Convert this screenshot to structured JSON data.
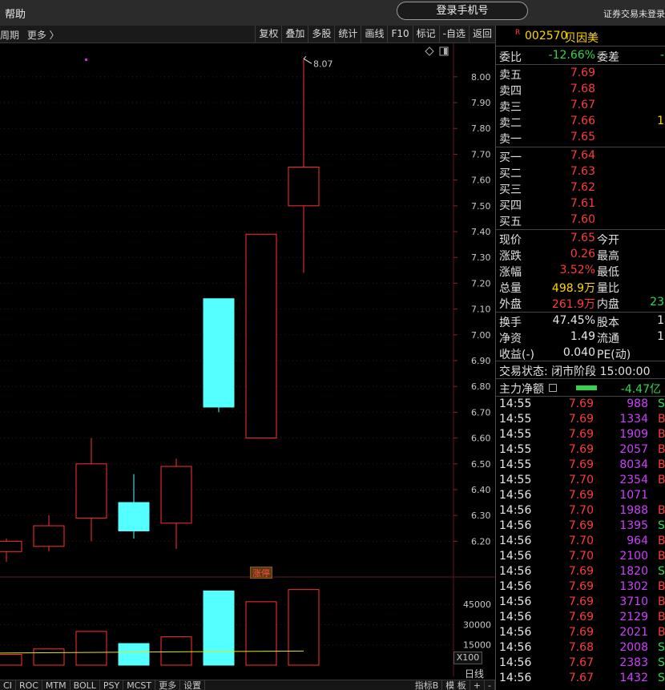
{
  "topbar": {
    "help": "帮助",
    "login_button": "登录手机号",
    "status": "证券交易未登录"
  },
  "toolbar": {
    "left": [
      "周期",
      "更多 〉"
    ],
    "right": [
      "复权",
      "叠加",
      "多股",
      "统计",
      "画线",
      "F10",
      "标记",
      "-自选",
      "返回"
    ]
  },
  "chart": {
    "max_label": "8.07",
    "tag_zt": "涨停",
    "x100": "X100",
    "day_line": "日线",
    "price_ticks": [
      "8.00",
      "7.90",
      "7.80",
      "7.70",
      "7.60",
      "7.50",
      "7.40",
      "7.30",
      "7.20",
      "7.10",
      "7.00",
      "6.90",
      "6.80",
      "6.70",
      "6.60",
      "6.50",
      "6.40",
      "6.30",
      "6.20"
    ],
    "volume_ticks": [
      "45000",
      "30000",
      "15000"
    ]
  },
  "chart_data": {
    "type": "candlestick",
    "price_ylim": [
      6.08,
      8.13
    ],
    "volume_ylim": [
      0,
      57000
    ],
    "max_price": 8.07,
    "candles": [
      {
        "open": 6.16,
        "close": 6.2,
        "high": 6.21,
        "low": 6.12,
        "volume": 8000
      },
      {
        "open": 6.18,
        "close": 6.26,
        "high": 6.3,
        "low": 6.16,
        "volume": 12000
      },
      {
        "open": 6.29,
        "close": 6.5,
        "high": 6.6,
        "low": 6.2,
        "volume": 25000
      },
      {
        "open": 6.35,
        "close": 6.24,
        "high": 6.46,
        "low": 6.21,
        "volume": 16000
      },
      {
        "open": 6.27,
        "close": 6.49,
        "high": 6.52,
        "low": 6.17,
        "volume": 21000
      },
      {
        "open": 7.14,
        "close": 6.72,
        "high": 7.14,
        "low": 6.7,
        "volume": 55000
      },
      {
        "open": 6.6,
        "close": 7.39,
        "high": 7.39,
        "low": 6.6,
        "volume": 47000
      },
      {
        "open": 7.5,
        "close": 7.65,
        "high": 8.07,
        "low": 7.24,
        "volume": 56000
      }
    ],
    "volume_ma": [
      {
        "x": 0,
        "value": 9000
      },
      {
        "x": 8,
        "value": 10500
      }
    ]
  },
  "indicators": {
    "left": [
      "CI",
      "ROC",
      "MTM",
      "BOLL",
      "PSY",
      "MCST",
      "更多",
      "设置"
    ],
    "right": [
      "指标B",
      "模 板",
      "+",
      "-"
    ]
  },
  "quote": {
    "badge": "R",
    "code": "002570",
    "name": "贝因美",
    "weibi_label": "委比",
    "weibi_value": "-12.66%",
    "weicha_label": "委差",
    "weicha_value": "-",
    "asks": [
      {
        "label": "卖五",
        "price": "7.69",
        "vol": ""
      },
      {
        "label": "卖四",
        "price": "7.68",
        "vol": ""
      },
      {
        "label": "卖三",
        "price": "7.67",
        "vol": ""
      },
      {
        "label": "卖二",
        "price": "7.66",
        "vol": "1"
      },
      {
        "label": "卖一",
        "price": "7.65",
        "vol": ""
      }
    ],
    "bids": [
      {
        "label": "买一",
        "price": "7.64"
      },
      {
        "label": "买二",
        "price": "7.63"
      },
      {
        "label": "买三",
        "price": "7.62"
      },
      {
        "label": "买四",
        "price": "7.61"
      },
      {
        "label": "买五",
        "price": "7.60"
      }
    ],
    "stats": [
      {
        "l1": "现价",
        "v1": "7.65",
        "c1": "red",
        "l2": "今开",
        "v2": "",
        "c2": "white"
      },
      {
        "l1": "涨跌",
        "v1": "0.26",
        "c1": "red",
        "l2": "最高",
        "v2": "",
        "c2": "white"
      },
      {
        "l1": "涨幅",
        "v1": "3.52%",
        "c1": "red",
        "l2": "最低",
        "v2": "",
        "c2": "white"
      },
      {
        "l1": "总量",
        "v1": "498.9万",
        "c1": "yellow",
        "l2": "量比",
        "v2": "",
        "c2": "white"
      },
      {
        "l1": "外盘",
        "v1": "261.9万",
        "c1": "red",
        "l2": "内盘",
        "v2": "23",
        "c2": "green"
      }
    ],
    "fund": [
      {
        "l1": "换手",
        "v1": "47.45%",
        "l2": "股本",
        "v2": "1"
      },
      {
        "l1": "净资",
        "v1": "1.49",
        "l2": "流通",
        "v2": "1"
      },
      {
        "l1": "收益(-)",
        "v1": "0.040",
        "l2": "PE(动)",
        "v2": ""
      }
    ],
    "trade_status": "交易状态: 闭市阶段 15:00:00",
    "main_flow_label": "主力净额",
    "main_flow_value": "-4.47亿",
    "ticks": [
      {
        "time": "14:55",
        "price": "7.69",
        "vol": "988",
        "side": "S"
      },
      {
        "time": "14:55",
        "price": "7.69",
        "vol": "1334",
        "side": "B"
      },
      {
        "time": "14:55",
        "price": "7.69",
        "vol": "1909",
        "side": "B"
      },
      {
        "time": "14:55",
        "price": "7.69",
        "vol": "2057",
        "side": "B"
      },
      {
        "time": "14:55",
        "price": "7.69",
        "vol": "8034",
        "side": "B"
      },
      {
        "time": "14:55",
        "price": "7.70",
        "vol": "2354",
        "side": "B"
      },
      {
        "time": "14:56",
        "price": "7.69",
        "vol": "1071",
        "side": ""
      },
      {
        "time": "14:56",
        "price": "7.70",
        "vol": "1988",
        "side": "B"
      },
      {
        "time": "14:56",
        "price": "7.69",
        "vol": "1395",
        "side": "S"
      },
      {
        "time": "14:56",
        "price": "7.70",
        "vol": "964",
        "side": "B"
      },
      {
        "time": "14:56",
        "price": "7.70",
        "vol": "2100",
        "side": "B"
      },
      {
        "time": "14:56",
        "price": "7.69",
        "vol": "1820",
        "side": "S"
      },
      {
        "time": "14:56",
        "price": "7.69",
        "vol": "1302",
        "side": "B"
      },
      {
        "time": "14:56",
        "price": "7.69",
        "vol": "3710",
        "side": "B"
      },
      {
        "time": "14:56",
        "price": "7.69",
        "vol": "2129",
        "side": "B"
      },
      {
        "time": "14:56",
        "price": "7.69",
        "vol": "2021",
        "side": "B"
      },
      {
        "time": "14:56",
        "price": "7.68",
        "vol": "2008",
        "side": "S"
      },
      {
        "time": "14:56",
        "price": "7.67",
        "vol": "2383",
        "side": "S"
      },
      {
        "time": "14:56",
        "price": "7.67",
        "vol": "1432",
        "side": "S"
      }
    ]
  }
}
